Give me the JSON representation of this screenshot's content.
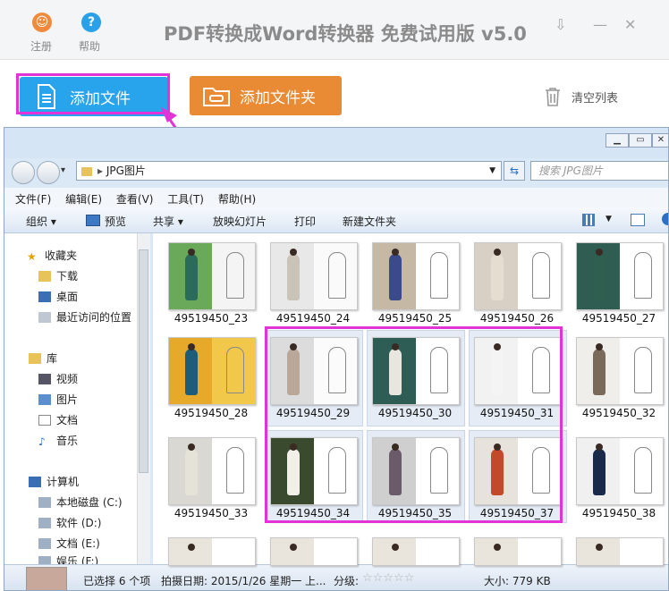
{
  "titlebar": {
    "register_label": "注册",
    "help_label": "帮助",
    "title": "PDF转换成Word转换器 免费试用版 v5.0",
    "minimize_glyph": "⇩",
    "close_glyph": "✕",
    "min2_glyph": "—"
  },
  "toolbar": {
    "add_file_label": "添加文件",
    "add_folder_label": "添加文件夹",
    "clear_list_label": "清空列表"
  },
  "explorer": {
    "address": "JPG图片",
    "search_placeholder": "搜索 JPG图片",
    "menu": [
      "文件(F)",
      "编辑(E)",
      "查看(V)",
      "工具(T)",
      "帮助(H)"
    ],
    "commands": {
      "organize": "组织 ▾",
      "preview": "预览",
      "share": "共享 ▾",
      "slideshow": "放映幻灯片",
      "print": "打印",
      "new_folder": "新建文件夹"
    },
    "nav": {
      "favorites": "收藏夹",
      "downloads": "下载",
      "desktop": "桌面",
      "recent": "最近访问的位置",
      "libraries": "库",
      "videos": "视频",
      "pictures": "图片",
      "documents": "文档",
      "music": "音乐",
      "computer": "计算机",
      "drive_c": "本地磁盘 (C:)",
      "drive_d": "软件 (D:)",
      "drive_e": "文档 (E:)",
      "drive_f": "娱乐 (F:)"
    },
    "files": [
      "49519450_23",
      "49519450_24",
      "49519450_25",
      "49519450_26",
      "49519450_27",
      "49519450_28",
      "49519450_29",
      "49519450_30",
      "49519450_31",
      "49519450_32",
      "49519450_33",
      "49519450_34",
      "49519450_35",
      "49519450_37",
      "49519450_38"
    ],
    "status": {
      "selected": "已选择 6 个项",
      "date": "拍摄日期: 2015/1/26 星期一 上...",
      "rating_label": "分级:",
      "size": "大小: 779 KB"
    }
  },
  "colors": {
    "add_file": "#27a4ec",
    "add_folder": "#e98a35",
    "highlight": "#e233d6"
  }
}
